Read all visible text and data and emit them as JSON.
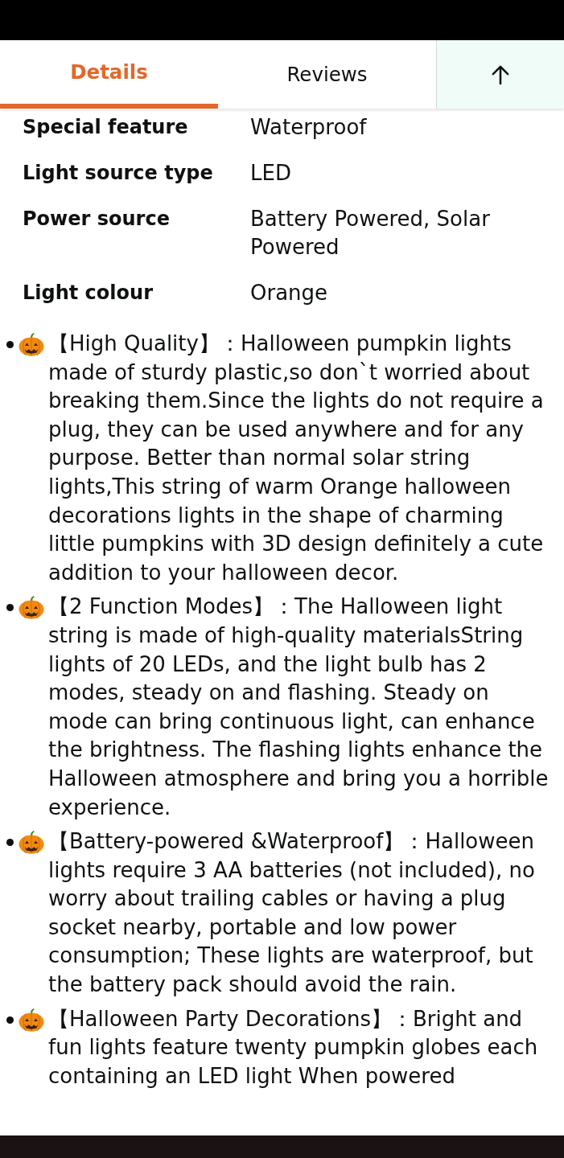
{
  "tabs": [
    {
      "label": "Details",
      "selected": true
    },
    {
      "label": "Reviews",
      "selected": false
    }
  ],
  "specs": [
    {
      "label": "Special feature",
      "value": "Waterproof"
    },
    {
      "label": "Light source type",
      "value": "LED"
    },
    {
      "label": "Power source",
      "value": "Battery Powered, Solar Powered"
    },
    {
      "label": "Light colour",
      "value": "Orange"
    }
  ],
  "bullets": [
    {
      "text": "【High Quality】：Halloween pumpkin lights made of sturdy plastic,so don`t worried about breaking them.Since the lights do not require a plug, they can be used anywhere and for any purpose. Better than normal solar string lights,This string of warm Orange halloween decorations lights in the shape of charming little pumpkins with 3D design definitely a cute addition to your halloween decor."
    },
    {
      "text": "【2 Function Modes】：The Halloween light string is made of high-quality materialsString lights of 20 LEDs, and the light bulb has 2 modes, steady on and flashing. Steady on mode can bring continuous light, can enhance the brightness. The flashing lights enhance the Halloween atmosphere and bring you a horrible experience."
    },
    {
      "text": "【Battery-powered &Waterproof】：Halloween lights require 3 AA batteries (not included), no worry about trailing cables or having a plug socket nearby, portable and low power consumption; These lights are waterproof, but the battery pack should avoid the rain."
    },
    {
      "text": "【Halloween Party Decorations】：Bright and fun lights feature twenty pumpkin globes each containing an LED light When powered"
    }
  ]
}
